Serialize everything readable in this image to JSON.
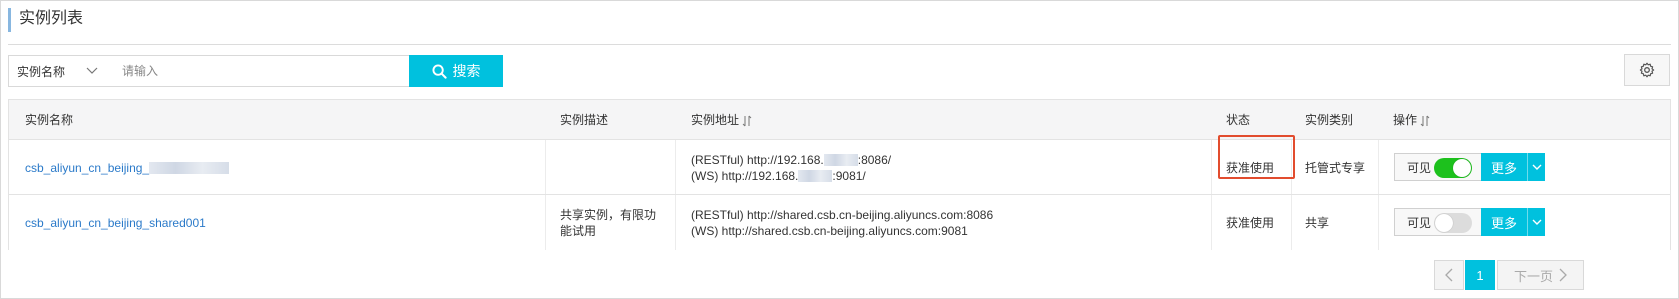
{
  "page": {
    "title": "实例列表"
  },
  "search": {
    "field_select": "实例名称",
    "placeholder": "请输入",
    "button_label": "搜索"
  },
  "table": {
    "headers": {
      "name": "实例名称",
      "description": "实例描述",
      "address": "实例地址",
      "status": "状态",
      "type": "实例类别",
      "actions": "操作"
    },
    "rows": [
      {
        "name": "csb_aliyun_cn_beijing_",
        "description": "",
        "address_restful": "(RESTful) http://192.168.",
        "address_restful_port": ":8086/",
        "address_ws": "(WS) http://192.168.",
        "address_ws_port": ":9081/",
        "status": "获准使用",
        "type": "托管式专享",
        "visible_label": "可见",
        "visible": true,
        "more_label": "更多"
      },
      {
        "name": "csb_aliyun_cn_beijing_shared001",
        "description": "共享实例，有限功能试用",
        "address_restful": "(RESTful) http://shared.csb.cn-beijing.aliyuncs.com:8086",
        "address_ws": "(WS) http://shared.csb.cn-beijing.aliyuncs.com:9081",
        "status": "获准使用",
        "type": "共享",
        "visible_label": "可见",
        "visible": false,
        "more_label": "更多"
      }
    ]
  },
  "pagination": {
    "current_page": "1",
    "next_label": "下一页"
  },
  "colors": {
    "accent": "#00c1de",
    "link": "#2b7ac9",
    "switch_on": "#1dc11d",
    "highlight": "#e24c2e"
  }
}
